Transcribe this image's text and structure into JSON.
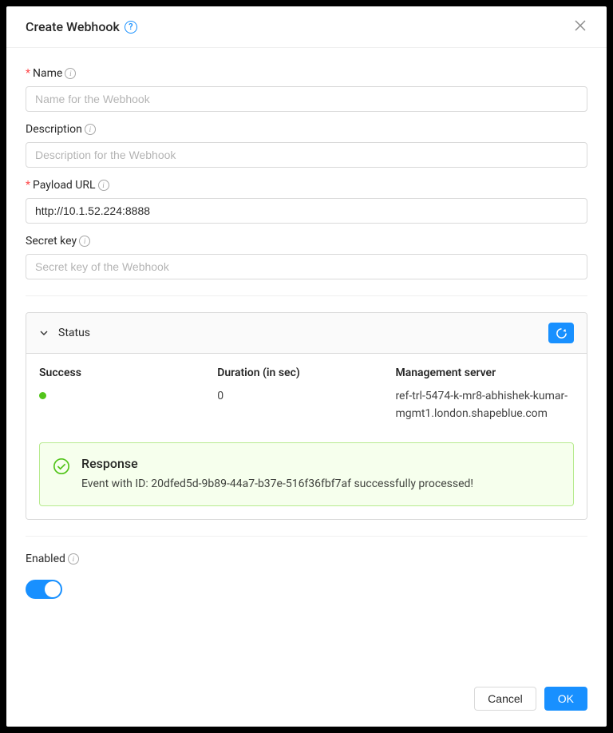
{
  "header": {
    "title": "Create Webhook"
  },
  "form": {
    "name": {
      "label": "Name",
      "value": "",
      "placeholder": "Name for the Webhook",
      "required": true
    },
    "description": {
      "label": "Description",
      "value": "",
      "placeholder": "Description for the Webhook",
      "required": false
    },
    "payload_url": {
      "label": "Payload URL",
      "value": "http://10.1.52.224:8888",
      "placeholder": "",
      "required": true
    },
    "secret_key": {
      "label": "Secret key",
      "value": "",
      "placeholder": "Secret key of the Webhook",
      "required": false
    }
  },
  "status_panel": {
    "title": "Status",
    "columns": {
      "success": {
        "label": "Success"
      },
      "duration": {
        "label": "Duration (in sec)",
        "value": "0"
      },
      "mgmt_server": {
        "label": "Management server",
        "value": "ref-trl-5474-k-mr8-abhishek-kumar-mgmt1.london.shapeblue.com"
      }
    },
    "response": {
      "title": "Response",
      "message": "Event with ID: 20dfed5d-9b89-44a7-b37e-516f36fbf7af successfully processed!"
    }
  },
  "enabled": {
    "label": "Enabled",
    "value": true
  },
  "footer": {
    "cancel": "Cancel",
    "ok": "OK"
  }
}
